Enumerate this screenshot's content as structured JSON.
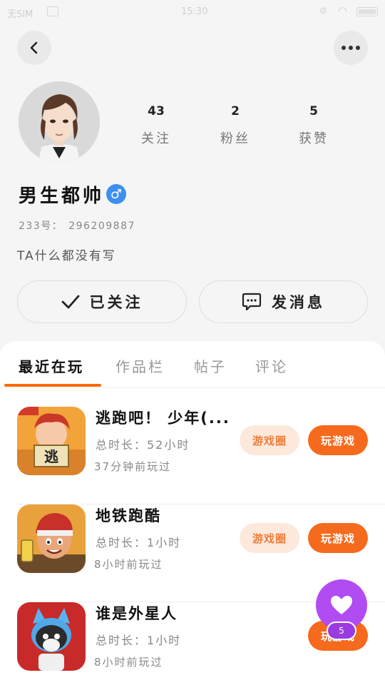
{
  "status_bar": {
    "carrier": "无SIM",
    "time": "15:30"
  },
  "profile": {
    "stats": [
      {
        "value": "43",
        "label": "关注"
      },
      {
        "value": "2",
        "label": "粉丝"
      },
      {
        "value": "5",
        "label": "获赞"
      }
    ],
    "username": "男生都帅",
    "gender_symbol": "♂",
    "uid_label": "233号：",
    "uid_value": "296209887",
    "bio": "TA什么都没有写"
  },
  "actions": {
    "follow_label": "已关注",
    "message_label": "发消息"
  },
  "tabs": [
    {
      "label": "最近在玩",
      "active": true
    },
    {
      "label": "作品栏",
      "active": false
    },
    {
      "label": "帖子",
      "active": false
    },
    {
      "label": "评论",
      "active": false
    }
  ],
  "games": [
    {
      "name": "逃跑吧！ 少年(...",
      "duration": "总时长：52小时",
      "last_played": "37分钟前玩过",
      "circle_label": "游戏圈",
      "play_label": "玩游戏"
    },
    {
      "name": "地铁跑酷",
      "duration": "总时长：1小时",
      "last_played": "8小时前玩过",
      "circle_label": "游戏圈",
      "play_label": "玩游戏"
    },
    {
      "name": "谁是外星人",
      "duration": "总时长：1小时",
      "last_played": "8小时前玩过",
      "play_label": "玩游戏"
    }
  ],
  "like_button": {
    "count": "5"
  },
  "colors": {
    "accent": "#f56a1c",
    "like": "#b14cf2",
    "gender": "#3d8ff0"
  }
}
